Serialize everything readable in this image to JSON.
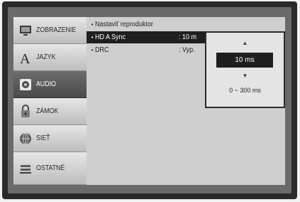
{
  "sidebar": {
    "items": [
      {
        "label": "ZOBRAZENIE",
        "icon": "display-icon",
        "active": false
      },
      {
        "label": "JAZYK",
        "icon": "language-icon",
        "active": false
      },
      {
        "label": "AUDIO",
        "icon": "audio-icon",
        "active": true
      },
      {
        "label": "ZÁMOK",
        "icon": "lock-icon",
        "active": false
      },
      {
        "label": "SIEŤ",
        "icon": "network-icon",
        "active": false
      },
      {
        "label": "OSTATNÉ",
        "icon": "other-icon",
        "active": false
      }
    ]
  },
  "settings": {
    "rows": [
      {
        "label": "Nastaviť reproduktor",
        "value": ""
      },
      {
        "label": "HD A Sync",
        "value": ": 10 m"
      },
      {
        "label": "DRC",
        "value": ": Vyp."
      }
    ]
  },
  "popup": {
    "up_arrow": "▲",
    "current_value": "10 ms",
    "down_arrow": "▼",
    "range": "0 ~ 300 ms"
  },
  "colors": {
    "highlight": "#1f1f1f",
    "panel": "#d5d5d5",
    "active_tab": "#555555"
  }
}
